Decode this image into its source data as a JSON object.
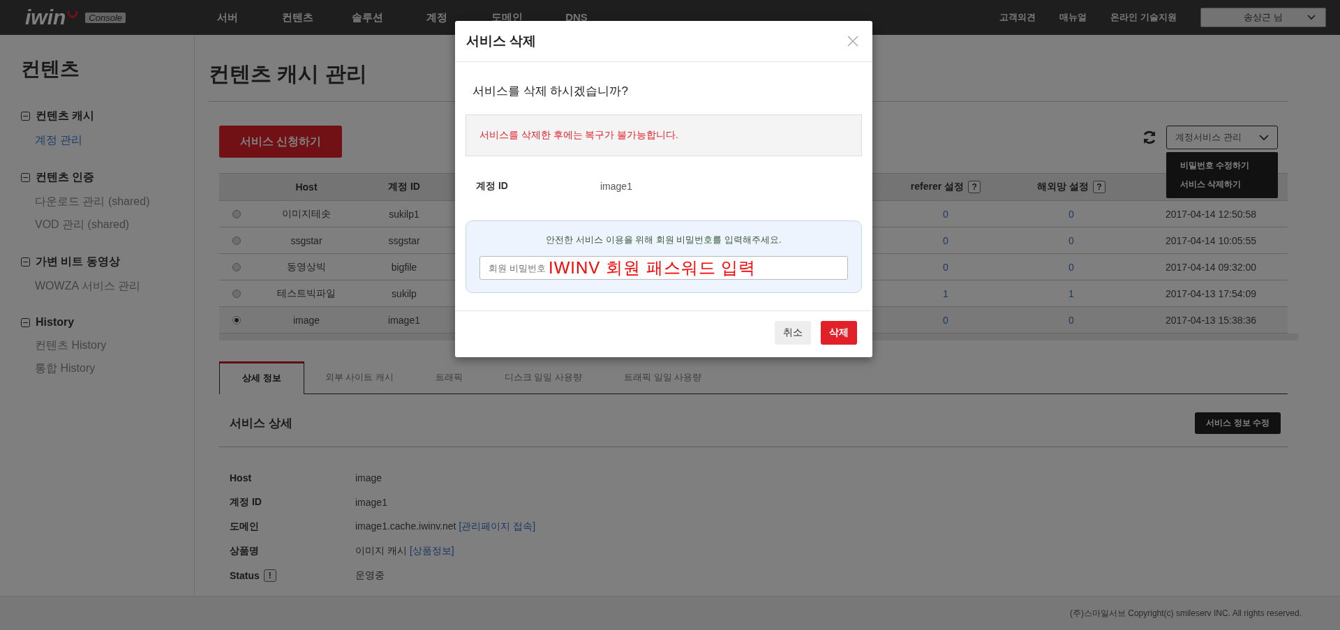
{
  "header": {
    "logo": "iwin",
    "logo_badge": "Console",
    "nav": [
      "서버",
      "컨텐츠",
      "솔루션",
      "계정",
      "도메인",
      "DNS"
    ],
    "links": [
      "고객의견",
      "매뉴얼",
      "온라인 기술지원"
    ],
    "user": "송상근 님"
  },
  "sidebar": {
    "title": "컨텐츠",
    "groups": [
      {
        "label": "컨텐츠 캐시",
        "expanded": true,
        "children": [
          {
            "label": "계정 관리",
            "selected": true
          }
        ]
      },
      {
        "label": "컨텐츠 인증",
        "expanded": true,
        "children": [
          {
            "label": "다운로드 관리 (shared)",
            "selected": false
          },
          {
            "label": "VOD 관리 (shared)",
            "selected": false
          }
        ]
      },
      {
        "label": "가변 비트 동영상",
        "expanded": true,
        "children": [
          {
            "label": "WOWZA 서비스 관리",
            "selected": false
          }
        ]
      },
      {
        "label": "History",
        "expanded": true,
        "children": [
          {
            "label": "컨텐츠 History",
            "selected": false
          },
          {
            "label": "통합 History",
            "selected": false
          }
        ]
      }
    ]
  },
  "page": {
    "title": "컨텐츠 캐시 관리",
    "apply_button": "서비스 신청하기",
    "manage_select": "계정서비스 관리",
    "manage_menu": [
      "비밀번호 수정하기",
      "서비스 삭제하기"
    ]
  },
  "table": {
    "columns": [
      {
        "label": "Host"
      },
      {
        "label": "계정 ID"
      },
      {
        "label": "referer 설정",
        "help": "?"
      },
      {
        "label": "해외망 설정",
        "help": "?"
      }
    ],
    "rows": [
      {
        "selected": false,
        "host": "이미지테솟",
        "account_id": "sukilp1",
        "referer": "0",
        "overseas": "0",
        "date": "2017-04-14 12:50:58"
      },
      {
        "selected": false,
        "host": "ssgstar",
        "account_id": "ssgstar",
        "referer": "0",
        "overseas": "0",
        "date": "2017-04-14 10:05:55"
      },
      {
        "selected": false,
        "host": "동영상빅",
        "account_id": "bigfile",
        "referer": "0",
        "overseas": "0",
        "date": "2017-04-14 09:32:00"
      },
      {
        "selected": false,
        "host": "테스트빅파일",
        "account_id": "sukilp",
        "referer": "1",
        "overseas": "1",
        "date": "2017-04-13 17:54:09"
      },
      {
        "selected": true,
        "host": "image",
        "account_id": "image1",
        "referer": "0",
        "overseas": "0",
        "date": "2017-04-13 15:38:36"
      }
    ]
  },
  "tabs": [
    {
      "label": "상세 정보",
      "selected": true
    },
    {
      "label": "외부 사이트 캐시",
      "selected": false
    },
    {
      "label": "트래픽",
      "selected": false
    },
    {
      "label": "디스크 일일 사용량",
      "selected": false
    },
    {
      "label": "트래픽 일일 사용량",
      "selected": false
    }
  ],
  "details": {
    "title": "서비스 상세",
    "edit_button": "서비스 정보 수정",
    "rows": [
      {
        "label": "Host",
        "value": "image"
      },
      {
        "label": "계정 ID",
        "value": "image1"
      },
      {
        "label": "도메인",
        "value": "image1.cache.iwinv.net",
        "link": "[관리페이지 접속]"
      },
      {
        "label": "상품명",
        "value": "이미지 캐시",
        "link": "[상품정보]"
      },
      {
        "label": "Status",
        "badge": "!",
        "value": "운영중"
      }
    ]
  },
  "footer": "(주)스마일서브 Copyright(c) smileserv INC. All rights reserved.",
  "modal": {
    "title": "서비스 삭제",
    "question": "서비스를 삭제 하시겠습니까?",
    "warning": "서비스를 삭제한 후에는 복구가 불가능합니다.",
    "field_label": "계정 ID",
    "field_value": "image1",
    "prompt": "안전한 서비스 이용을 위해 회원 비밀번호를 입력해주세요.",
    "placeholder": "회원 비밀번호",
    "annotation": "IWINV 회원 패스워드 입력",
    "cancel": "취소",
    "confirm": "삭제"
  }
}
